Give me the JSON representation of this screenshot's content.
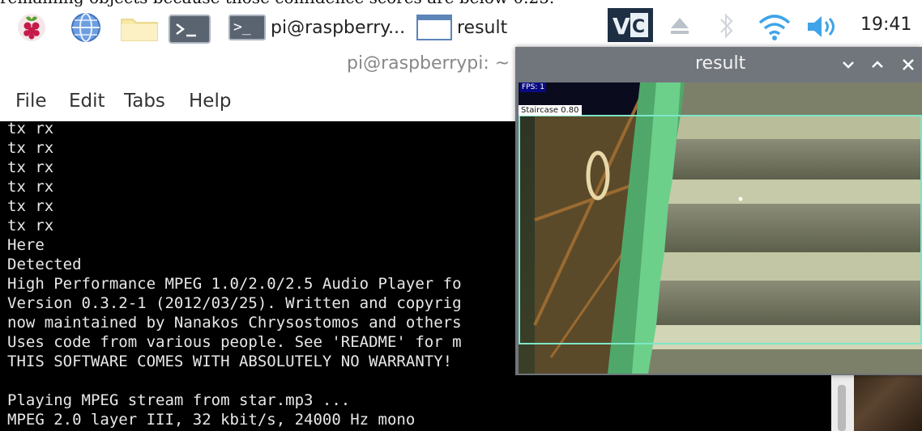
{
  "caption": "remaining objects because those confidence scores are below 0.25.",
  "taskbar": {
    "icons": [
      "raspberry-pi-menu-icon",
      "web-browser-icon",
      "file-manager-icon",
      "terminal-icon"
    ],
    "tasks": [
      {
        "label": "pi@raspberry...",
        "icon": "terminal-icon"
      },
      {
        "label": "result",
        "icon": "window-icon"
      }
    ],
    "tray": [
      "vnc-icon",
      "eject-icon",
      "bluetooth-icon",
      "wifi-icon",
      "volume-icon"
    ],
    "clock": "19:41"
  },
  "terminal": {
    "title": "pi@raspberrypi: ~",
    "menu": [
      "File",
      "Edit",
      "Tabs",
      "Help"
    ],
    "lines": [
      "tx rx",
      "tx rx",
      "tx rx",
      "tx rx",
      "tx rx",
      "tx rx",
      "Here",
      "Detected",
      "High Performance MPEG 1.0/2.0/2.5 Audio Player fo",
      "Version 0.3.2-1 (2012/03/25). Written and copyrig",
      "now maintained by Nanakos Chrysostomos and others",
      "Uses code from various people. See 'README' for m",
      "THIS SOFTWARE COMES WITH ABSOLUTELY NO WARRANTY! ",
      "",
      "Playing MPEG stream from star.mp3 ...",
      "MPEG 2.0 layer III, 32 kbit/s, 24000 Hz mono"
    ]
  },
  "result_window": {
    "title": "result",
    "fps_label": "FPS: 1",
    "detection_label": "Staircase  0.80",
    "detection_class": "Staircase",
    "detection_score": 0.8,
    "box_color": "#7ee6c8"
  },
  "colors": {
    "terminal_bg": "#000000",
    "terminal_fg": "#e8e8e8",
    "result_titlebar": "#71767d"
  }
}
